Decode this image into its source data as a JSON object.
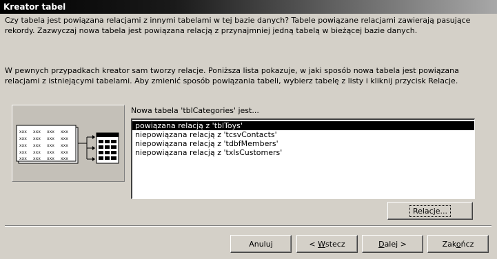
{
  "window": {
    "title": "Kreator tabel"
  },
  "intro": "Czy tabela jest powiązana relacjami z innymi tabelami w tej bazie danych? Tabele powiązane relacjami zawierają pasujące rekordy. Zazwyczaj nowa tabela jest powiązana relacją z przynajmniej jedną tabelą w bieżącej bazie danych.",
  "explanation": "W pewnych przypadkach kreator sam tworzy relacje. Poniższa lista pokazuje, w jaki sposób nowa tabela jest powiązana relacjami z istniejącymi tabelami. Aby zmienić sposób powiązania tabeli, wybierz tabelę z listy i kliknij przycisk Relacje.",
  "list": {
    "label": "Nowa tabela 'tblCategories' jest...",
    "items": [
      "powiązana relacją z 'tblToys'",
      "niepowiązana relacją z 'tcsvContacts'",
      "niepowiązana relacją z 'tdbfMembers'",
      "niepowiązana relacją z 'txlsCustomers'"
    ],
    "selected_index": 0
  },
  "buttons": {
    "relations": "Relacje...",
    "cancel": "Anuluj",
    "back_prefix": "< ",
    "back_mnemonic": "W",
    "back_rest": "stecz",
    "next_mnemonic": "D",
    "next_rest": "alej >",
    "finish_pre": "Zak",
    "finish_mnemonic": "o",
    "finish_rest": "ńcz"
  },
  "illustration": {
    "cell_text": "xxx",
    "icon": "table-relationship-icon"
  },
  "colors": {
    "dialog_bg": "#d4d0c8",
    "selection": "#000000"
  }
}
